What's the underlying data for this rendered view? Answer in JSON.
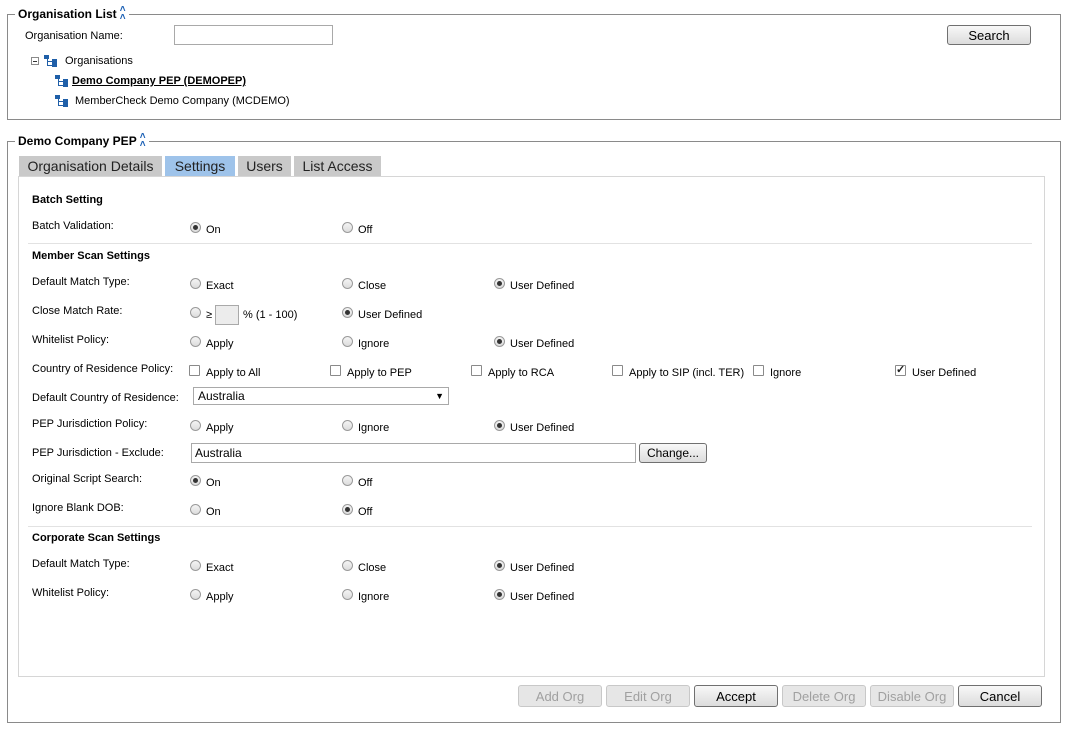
{
  "org_list": {
    "legend": "Organisation List",
    "name_label": "Organisation Name:",
    "name_value": "",
    "search_label": "Search",
    "tree_root": "Organisations",
    "orgs": [
      "Demo Company PEP (DEMOPEP)",
      "MemberCheck Demo Company (MCDEMO)"
    ]
  },
  "detail": {
    "legend": "Demo Company PEP",
    "tabs": [
      "Organisation Details",
      "Settings",
      "Users",
      "List Access"
    ],
    "active_tab": "Settings"
  },
  "batch": {
    "title": "Batch Setting",
    "validation_label": "Batch Validation:",
    "options": [
      "On",
      "Off"
    ],
    "selected": "On"
  },
  "member": {
    "title": "Member Scan Settings",
    "match_type_label": "Default Match Type:",
    "match_type_options": [
      "Exact",
      "Close",
      "User Defined"
    ],
    "match_type_selected": "User Defined",
    "close_rate_label": "Close Match Rate:",
    "close_rate_prefix": "≥",
    "close_rate_value": "",
    "close_rate_suffix": "% (1 - 100)",
    "close_rate_user_defined": "User Defined",
    "close_rate_selected": "User Defined",
    "whitelist_label": "Whitelist Policy:",
    "whitelist_options": [
      "Apply",
      "Ignore",
      "User Defined"
    ],
    "whitelist_selected": "User Defined",
    "residence_policy_label": "Country of Residence Policy:",
    "residence_policy_options": [
      "Apply to All",
      "Apply to PEP",
      "Apply to RCA",
      "Apply to SIP (incl. TER)",
      "Ignore",
      "User Defined"
    ],
    "residence_policy_checked": [
      "User Defined"
    ],
    "default_country_label": "Default Country of Residence:",
    "default_country_value": "Australia",
    "pep_jurisdiction_label": "PEP Jurisdiction Policy:",
    "pep_jurisdiction_options": [
      "Apply",
      "Ignore",
      "User Defined"
    ],
    "pep_jurisdiction_selected": "User Defined",
    "pep_exclude_label": "PEP Jurisdiction - Exclude:",
    "pep_exclude_value": "Australia",
    "change_label": "Change...",
    "script_search_label": "Original Script Search:",
    "script_search_options": [
      "On",
      "Off"
    ],
    "script_search_selected": "On",
    "blank_dob_label": "Ignore Blank DOB:",
    "blank_dob_options": [
      "On",
      "Off"
    ],
    "blank_dob_selected": "Off"
  },
  "corporate": {
    "title": "Corporate Scan Settings",
    "match_type_label": "Default Match Type:",
    "match_type_options": [
      "Exact",
      "Close",
      "User Defined"
    ],
    "match_type_selected": "User Defined",
    "whitelist_label": "Whitelist Policy:",
    "whitelist_options": [
      "Apply",
      "Ignore",
      "User Defined"
    ],
    "whitelist_selected": "User Defined"
  },
  "actions": {
    "buttons": [
      {
        "label": "Add Org",
        "enabled": false
      },
      {
        "label": "Edit Org",
        "enabled": false
      },
      {
        "label": "Accept",
        "enabled": true
      },
      {
        "label": "Delete Org",
        "enabled": false
      },
      {
        "label": "Disable Org",
        "enabled": false
      },
      {
        "label": "Cancel",
        "enabled": true
      }
    ]
  },
  "colors": {
    "active_tab": "#9ec3ea",
    "inactive_tab": "#c9c9c9",
    "icon_blue": "#1f5fa8"
  }
}
